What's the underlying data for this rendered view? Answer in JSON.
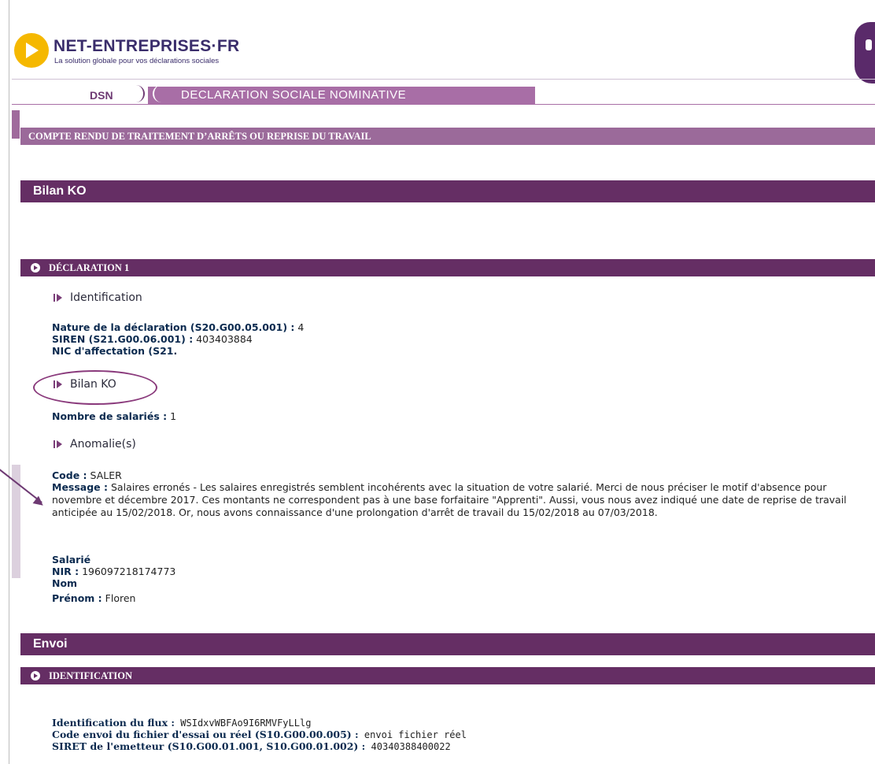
{
  "brand": {
    "name": "NET-ENTREPRISES·FR",
    "tagline": "La solution globale pour vos déclarations sociales"
  },
  "nav": {
    "tab_short": "DSN",
    "tab_full": "DECLARATION SOCIALE NOMINATIVE"
  },
  "page": {
    "section_title": "COMPTE RENDU DE TRAITEMENT D’ARRÊTS OU REPRISE DU TRAVAIL",
    "bilan_heading": "Bilan KO"
  },
  "declaration": {
    "title": "DÉCLARATION 1",
    "identification_label": "Identification",
    "nature_key": "Nature de la déclaration (S20.G00.05.001) :",
    "nature_val": "4",
    "siren_key": "SIREN (S21.G00.06.001) :",
    "siren_val": "403403884",
    "nic_key": "NIC d'affectation (S21.",
    "bilan_label": "Bilan KO",
    "nb_salaries_key": "Nombre de salariés :",
    "nb_salaries_val": "1",
    "anomalies_label": "Anomalie(s)",
    "code_key": "Code :",
    "code_val": "SALER",
    "message_key": "Message :",
    "message_val": "Salaires erronés - Les salaires enregistrés semblent incohérents avec la situation de votre salarié. Merci de nous préciser le motif d'absence pour novembre et décembre 2017. Ces montants ne correspondent pas à une base forfaitaire \"Apprenti\". Aussi, vous nous avez indiqué une date de reprise de travail anticipée au 15/02/2018. Or, nous avons connaissance d'une prolongation d'arrêt de travail du 15/02/2018 au 07/03/2018.",
    "salarie_label": "Salarié",
    "nir_key": "NIR :",
    "nir_val": "196097218174773",
    "nom_key": "Nom",
    "prenom_key": "Prénom :",
    "prenom_val": "Floren"
  },
  "envoi": {
    "heading": "Envoi",
    "identification_title": "IDENTIFICATION",
    "flux_key": "Identification du flux :",
    "flux_val": "WSIdxvWBFAo9I6RMVFyLLlg",
    "code_envoi_key": "Code envoi du fichier d'essai ou réel (S10.G00.00.005) :",
    "code_envoi_val": "envoi fichier réel",
    "siret_key": "SIRET de l'emetteur (S10.G00.01.001, S10.G00.01.002) :",
    "siret_val": "40340388400022"
  },
  "colors": {
    "header_bar": "#652e64",
    "section_band": "#9b6a9a",
    "nav_band": "#a86ea6",
    "logo_yellow": "#f5b800",
    "label_blue": "#0b2a4f"
  }
}
